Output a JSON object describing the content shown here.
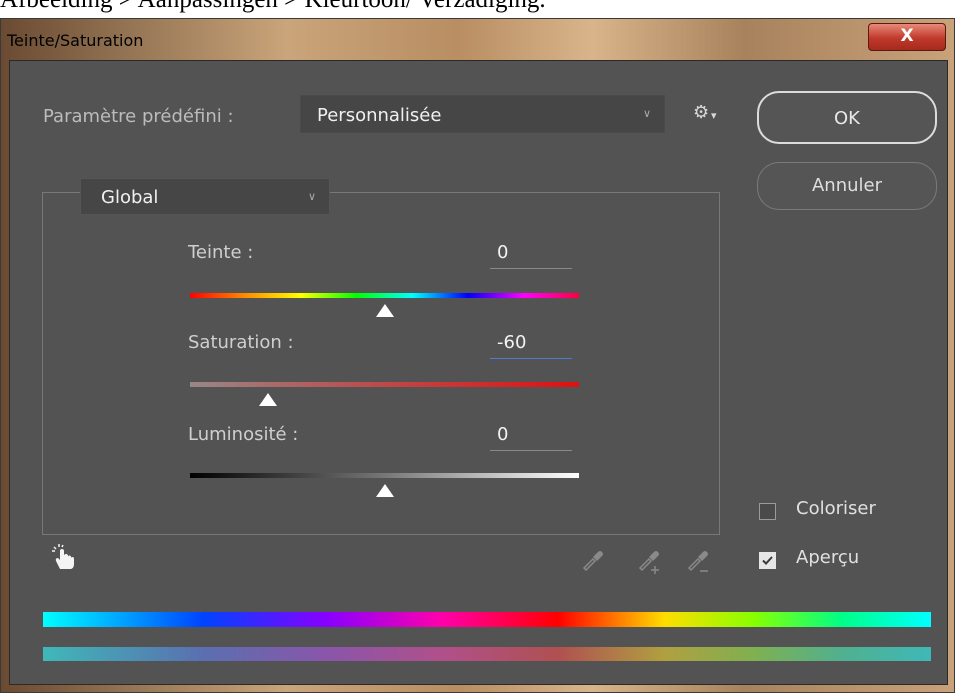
{
  "caption": "Afbeelding > Aanpassingen > Kleurtoon/ Verzadiging.",
  "window": {
    "title": "Teinte/Saturation",
    "close_label": "X"
  },
  "preset": {
    "label": "Paramètre prédéfini :",
    "value": "Personnalisée"
  },
  "buttons": {
    "ok": "OK",
    "cancel": "Annuler"
  },
  "channel": {
    "value": "Global"
  },
  "sliders": {
    "hue": {
      "label": "Teinte :",
      "value": "0",
      "level": 0.5
    },
    "saturation": {
      "label": "Saturation :",
      "value": "-60",
      "level": 0.2
    },
    "lightness": {
      "label": "Luminosité :",
      "value": "0",
      "level": 0.5
    }
  },
  "options": {
    "colorize": {
      "label": "Coloriser",
      "checked": false
    },
    "preview": {
      "label": "Aperçu",
      "checked": true
    }
  },
  "icons": [
    "gear-icon",
    "targeted-adjustment-hand-icon",
    "eyedropper-icon",
    "eyedropper-add-icon",
    "eyedropper-subtract-icon",
    "chevron-down-icon",
    "checkmark-icon"
  ],
  "colors": {
    "dialog_bg": "#535353",
    "field_bg": "#464646",
    "active_underline": "#4f7bd1",
    "close_button": "#c0392b"
  }
}
